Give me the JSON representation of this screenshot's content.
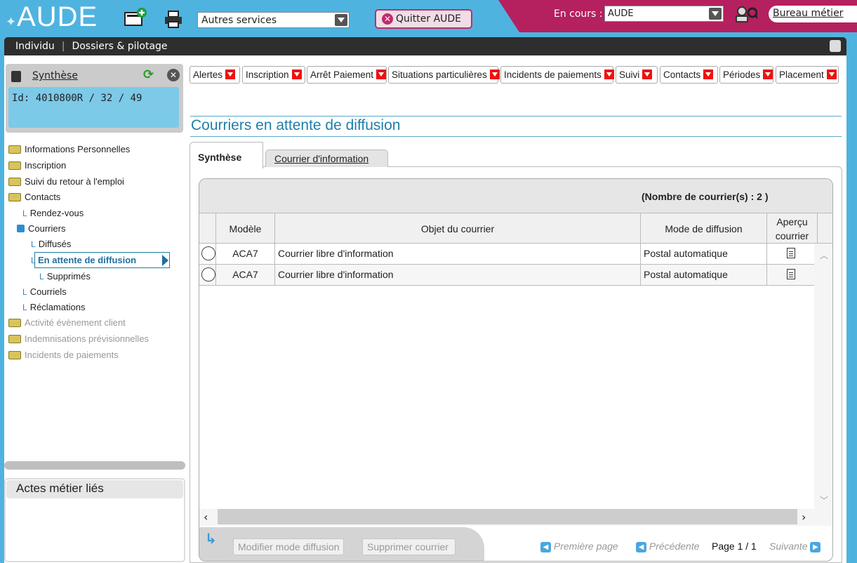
{
  "header": {
    "logo": "AUDE",
    "services_select": "Autres services",
    "quit_label": "Quitter AUDE",
    "encours_label": "En cours :",
    "encours_value": "AUDE",
    "bureau_link": "Bureau métier"
  },
  "nav": {
    "items": [
      "Individu",
      "Dossiers & pilotage"
    ]
  },
  "synthese": {
    "title": "Synthèse",
    "id": "Id: 4010800R / 32 / 49"
  },
  "tree": [
    {
      "label": "Informations Personnelles",
      "type": "folder"
    },
    {
      "label": "Inscription",
      "type": "folder"
    },
    {
      "label": "Suivi du retour à l'emploi",
      "type": "folder"
    },
    {
      "label": "Contacts",
      "type": "folder"
    },
    {
      "label": "Rendez-vous",
      "type": "leaf"
    },
    {
      "label": "Courriers",
      "type": "open"
    },
    {
      "label": "Diffusés",
      "type": "leaf"
    },
    {
      "label": "En attente de diffusion",
      "type": "selected"
    },
    {
      "label": "Supprimés",
      "type": "leaf"
    },
    {
      "label": "Courriels",
      "type": "leaf"
    },
    {
      "label": "Réclamations",
      "type": "leaf"
    },
    {
      "label": "Activité évènement client",
      "type": "folder-grey"
    },
    {
      "label": "Indemnisations prévisionnelles",
      "type": "folder-grey"
    },
    {
      "label": "Incidents de paiements",
      "type": "folder-grey"
    }
  ],
  "actes_title": "Actes métier liés",
  "menus": [
    "Alertes",
    "Inscription",
    "Arrêt Paiement",
    "Situations particulières",
    "Incidents de paiements",
    "Suivi",
    "Contacts",
    "Périodes",
    "Placement"
  ],
  "page_title": "Courriers en attente de diffusion",
  "tabs": [
    "Synthèse",
    "Courrier d'information"
  ],
  "grid": {
    "count": "(Nombre de courrier(s) : 2 )",
    "columns": [
      "Modèle",
      "Objet du courrier",
      "Mode de diffusion",
      "Aperçu courrier"
    ],
    "rows": [
      {
        "modele": "ACA7",
        "objet": "Courrier libre d'information",
        "mode": "Postal automatique"
      },
      {
        "modele": "ACA7",
        "objet": "Courrier libre d'information",
        "mode": "Postal automatique"
      }
    ]
  },
  "actions": {
    "modify": "Modifier mode diffusion",
    "delete": "Supprimer courrier"
  },
  "pagination": {
    "first": "Première page",
    "prev": "Précédente",
    "page": "Page 1 / 1",
    "next": "Suivante"
  }
}
